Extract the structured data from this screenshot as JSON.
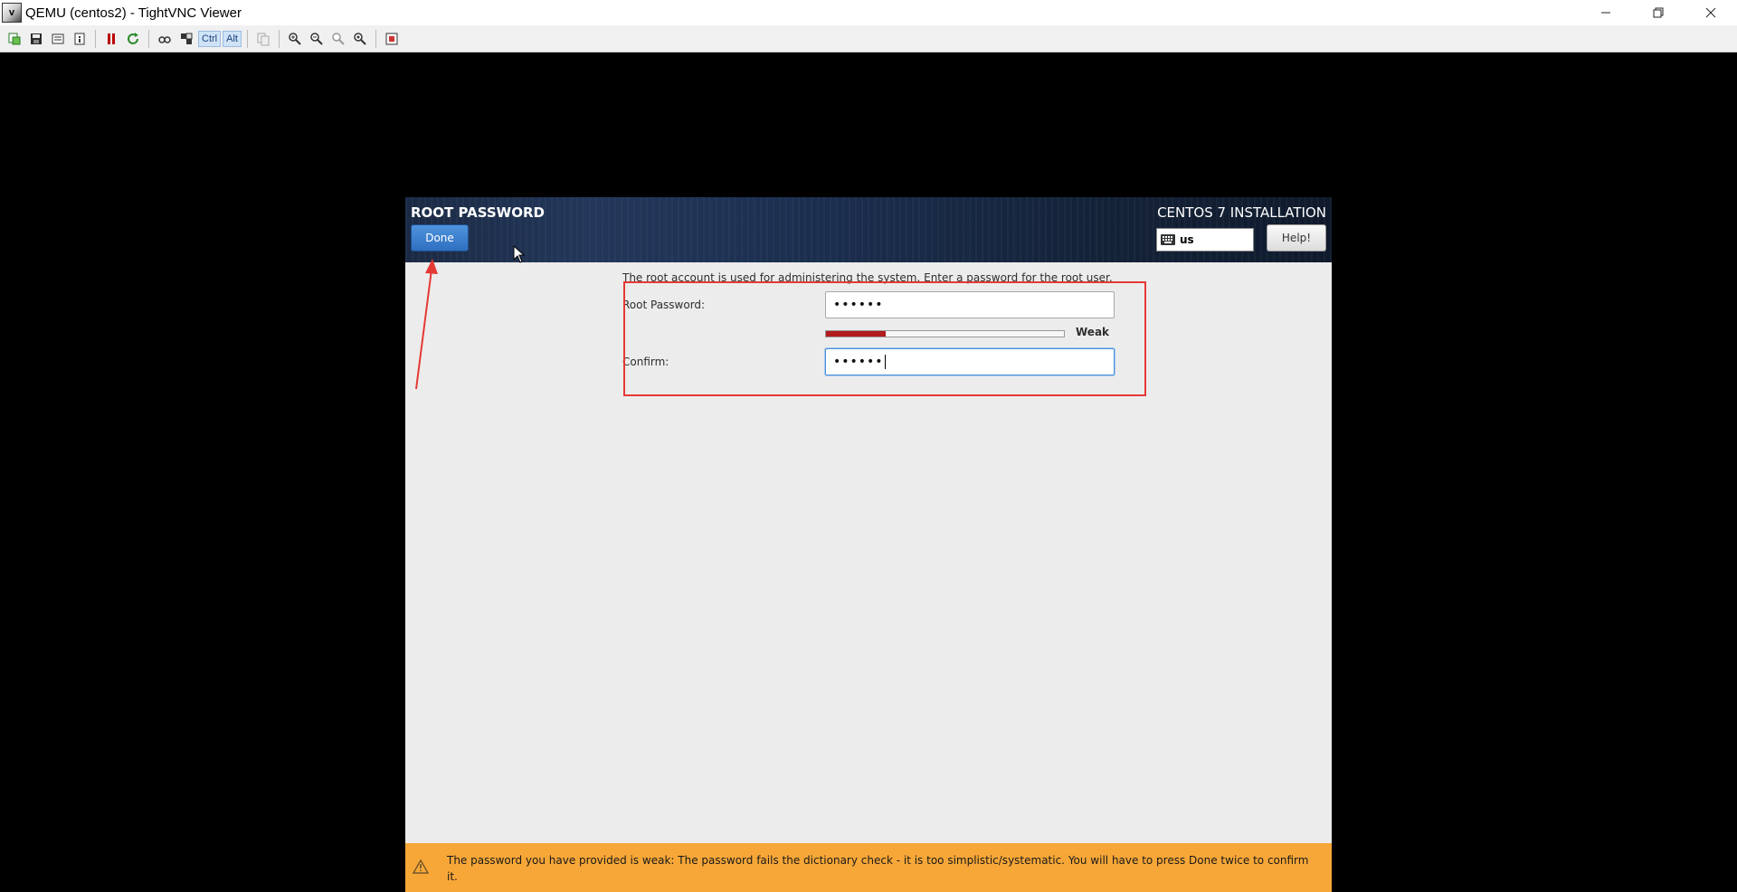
{
  "window": {
    "title": "QEMU (centos2) - TightVNC Viewer",
    "app_icon_text": "V"
  },
  "toolbar": {
    "ctrl_label": "Ctrl",
    "alt_label": "Alt"
  },
  "installer": {
    "page_title": "ROOT PASSWORD",
    "done_label": "Done",
    "install_title": "CENTOS 7 INSTALLATION",
    "keyboard_layout": "us",
    "help_label": "Help!",
    "description": "The root account is used for administering the system.  Enter a password for the root user.",
    "root_password_label": "Root Password:",
    "root_password_value": "••••••",
    "strength_label": "Weak",
    "strength_fraction": 0.25,
    "confirm_label": "Confirm:",
    "confirm_value": "••••••",
    "warning_text": "The password you have provided is weak: The password fails the dictionary check - it is too simplistic/systematic. You will have to press Done twice to confirm it."
  },
  "colors": {
    "warning_bg": "#f7a738",
    "done_btn": "#2f6fc0",
    "strength_fill": "#b21c1c",
    "annotation": "#e53935"
  }
}
